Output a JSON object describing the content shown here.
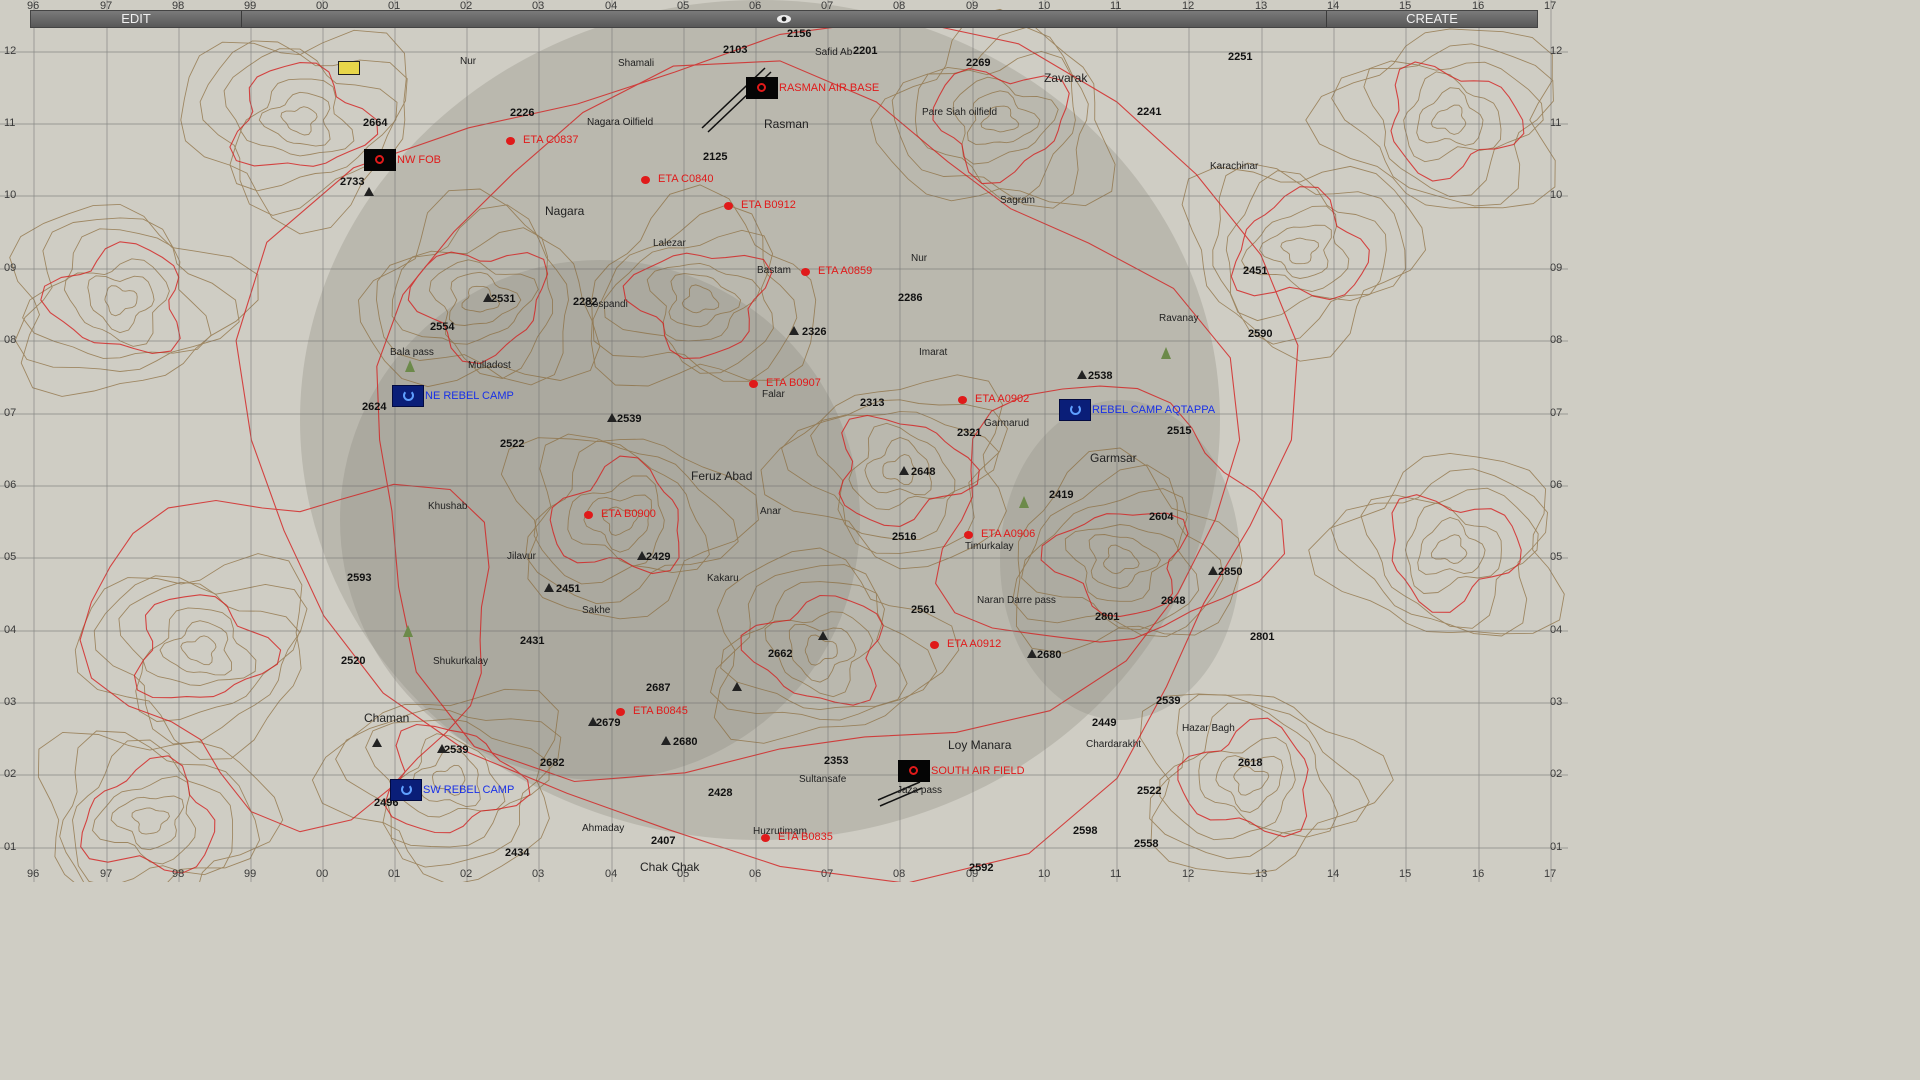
{
  "toolbar": {
    "edit_label": "EDIT",
    "create_label": "CREATE",
    "eye_icon": "eye-icon"
  },
  "grid": {
    "top_labels": [
      "96",
      "97",
      "98",
      "99",
      "00",
      "01",
      "02",
      "03",
      "04",
      "05",
      "06",
      "07",
      "08",
      "09",
      "10",
      "11",
      "12",
      "13",
      "14",
      "15",
      "16",
      "17"
    ],
    "left_labels": [
      "12",
      "11",
      "10",
      "09",
      "08",
      "07",
      "06",
      "05",
      "04",
      "03",
      "02",
      "01"
    ]
  },
  "places": [
    {
      "name": "Nur"
    },
    {
      "name": "Shamali"
    },
    {
      "name": "Rasman"
    },
    {
      "name": "Zavarak"
    },
    {
      "name": "Nagara Oilfield"
    },
    {
      "name": "Pare Siah oilfield"
    },
    {
      "name": "Karachinar"
    },
    {
      "name": "Nagara"
    },
    {
      "name": "Lalezar"
    },
    {
      "name": "Sagram"
    },
    {
      "name": "Bastam"
    },
    {
      "name": "Nur"
    },
    {
      "name": "Gospandi"
    },
    {
      "name": "Ravanay"
    },
    {
      "name": "Bala pass"
    },
    {
      "name": "Mulladost"
    },
    {
      "name": "Imarat"
    },
    {
      "name": "Falar"
    },
    {
      "name": "Garmarud"
    },
    {
      "name": "Garmsar"
    },
    {
      "name": "Feruz Abad"
    },
    {
      "name": "Khushab"
    },
    {
      "name": "Anar"
    },
    {
      "name": "Jilavur"
    },
    {
      "name": "Timurkalay"
    },
    {
      "name": "Kakaru"
    },
    {
      "name": "Sakhe"
    },
    {
      "name": "Naran Darre pass"
    },
    {
      "name": "Shukurkalay"
    },
    {
      "name": "Chaman"
    },
    {
      "name": "Sultansafe"
    },
    {
      "name": "Loy Manara"
    },
    {
      "name": "Chardarakht"
    },
    {
      "name": "Hazar Bagh"
    },
    {
      "name": "Ahmaday"
    },
    {
      "name": "Huzrutimam"
    },
    {
      "name": "Chak Chak"
    },
    {
      "name": "Safid Ab"
    },
    {
      "name": "Jaza pass"
    }
  ],
  "peaks": [
    "2156",
    "2103",
    "2201",
    "2269",
    "2251",
    "2664",
    "2226",
    "2241",
    "2125",
    "2733",
    "2451",
    "2531",
    "2282",
    "2286",
    "2554",
    "2326",
    "2590",
    "2538",
    "2624",
    "2539",
    "2313",
    "2321",
    "2515",
    "2522",
    "2648",
    "2419",
    "2604",
    "2516",
    "2593",
    "2429",
    "2451",
    "2850",
    "2848",
    "2561",
    "2801",
    "2431",
    "2801",
    "2520",
    "2662",
    "2680",
    "2687",
    "2539",
    "2679",
    "2680",
    "2449",
    "2539",
    "2682",
    "2353",
    "2618",
    "2496",
    "2428",
    "2522",
    "2407",
    "2598",
    "2434",
    "2558",
    "2592"
  ],
  "eta_markers": [
    {
      "label": "ETA C0837"
    },
    {
      "label": "ETA C0840"
    },
    {
      "label": "ETA B0912"
    },
    {
      "label": "ETA A0859"
    },
    {
      "label": "ETA B0907"
    },
    {
      "label": "ETA A0902"
    },
    {
      "label": "ETA B0900"
    },
    {
      "label": "ETA A0906"
    },
    {
      "label": "ETA A0912"
    },
    {
      "label": "ETA B0845"
    },
    {
      "label": "ETA B0835"
    }
  ],
  "bases": [
    {
      "label": "RASMAN AIR BASE",
      "side": "hostile"
    },
    {
      "label": "NW FOB",
      "side": "hostile"
    },
    {
      "label": "NE REBEL CAMP",
      "side": "friendly"
    },
    {
      "label": "REBEL CAMP AQTAPPA",
      "side": "friendly"
    },
    {
      "label": "SOUTH AIR FIELD",
      "side": "hostile"
    },
    {
      "label": "SW REBEL CAMP",
      "side": "friendly"
    }
  ],
  "colors": {
    "hostile": "#e01a1a",
    "friendly_label": "#1830e8",
    "friendly_marker": "#0a1e78",
    "contour": "#8a6a3a",
    "contour_major": "#d42020",
    "grid": "#6a6a6a",
    "terrain": "#cfcdc4"
  }
}
